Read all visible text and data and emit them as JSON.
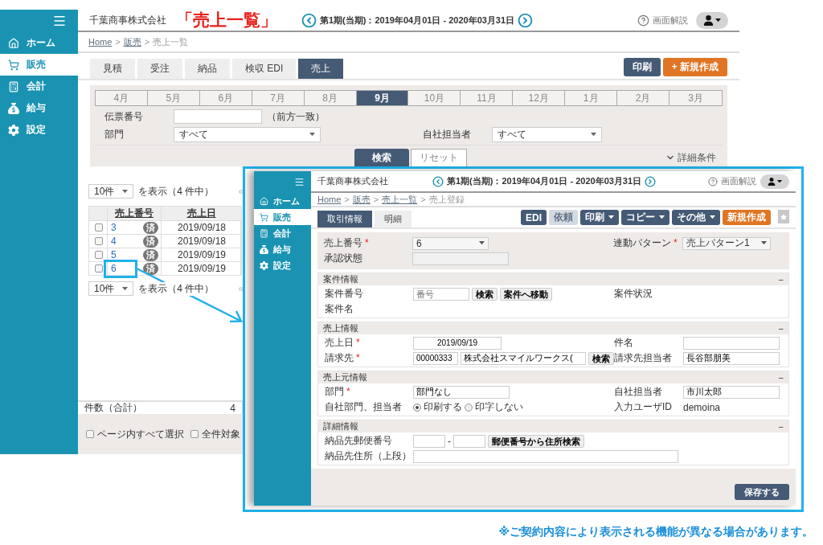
{
  "main": {
    "company": "千葉商事株式会社",
    "page_title": "「売上一覧」",
    "period": "第1期(当期)：2019年04月01日 - 2020年03月31日",
    "help": "画面解説"
  },
  "sidebar": {
    "items": [
      {
        "label": "ホーム",
        "selected": false
      },
      {
        "label": "販売",
        "selected": true
      },
      {
        "label": "会計",
        "selected": false
      },
      {
        "label": "給与",
        "selected": false
      },
      {
        "label": "設定",
        "selected": false
      }
    ]
  },
  "breadcrumb": {
    "separator": ">",
    "items": [
      {
        "label": "Home",
        "link": true
      },
      {
        "label": "販売",
        "link": true
      },
      {
        "label": "売上一覧",
        "link": false
      }
    ]
  },
  "tabs": [
    {
      "label": "見積",
      "selected": false
    },
    {
      "label": "受注",
      "selected": false
    },
    {
      "label": "納品",
      "selected": false
    },
    {
      "label": "検収 EDI",
      "selected": false
    },
    {
      "label": "売上",
      "selected": true
    }
  ],
  "actions": [
    {
      "label": "印刷",
      "kind": "dark"
    },
    {
      "label": "+ 新規作成",
      "kind": "primary"
    }
  ],
  "filter": {
    "months": [
      {
        "label": "4月",
        "selected": false
      },
      {
        "label": "5月",
        "selected": false
      },
      {
        "label": "6月",
        "selected": false
      },
      {
        "label": "7月",
        "selected": false
      },
      {
        "label": "8月",
        "selected": false
      },
      {
        "label": "9月",
        "selected": true
      },
      {
        "label": "10月",
        "selected": false
      },
      {
        "label": "11月",
        "selected": false
      },
      {
        "label": "12月",
        "selected": false
      },
      {
        "label": "1月",
        "selected": false
      },
      {
        "label": "2月",
        "selected": false
      },
      {
        "label": "3月",
        "selected": false
      }
    ],
    "slip": {
      "label": "伝票番号",
      "note": "（前方一致）"
    },
    "department": {
      "label": "部門",
      "value": "すべて"
    },
    "staff": {
      "label": "自社担当者",
      "value": "すべて"
    },
    "search": "検索",
    "reset": "リセット",
    "more": "詳細条件"
  },
  "pagers": [
    {
      "per_page": "10件",
      "summary": "を表示（4 件中）",
      "first": "«"
    },
    {
      "per_page": "10件",
      "summary": "を表示（4 件中）",
      "first": "«"
    }
  ],
  "table": {
    "columns": [
      "売上番号",
      "売上日"
    ],
    "rows": [
      {
        "checked": false,
        "number": "3",
        "badge": "済",
        "date": "2019/09/18",
        "highlighted": false
      },
      {
        "checked": false,
        "number": "4",
        "badge": "済",
        "date": "2019/09/18",
        "highlighted": false
      },
      {
        "checked": false,
        "number": "5",
        "badge": "済",
        "date": "2019/09/19",
        "highlighted": false
      },
      {
        "checked": false,
        "number": "6",
        "badge": "済",
        "date": "2019/09/19",
        "highlighted": true
      }
    ]
  },
  "totals": {
    "label": "件数（合計）",
    "value": "4"
  },
  "bulk": [
    {
      "label": "ページ内すべて選択",
      "checked": false
    },
    {
      "label": "全件対象",
      "checked": false
    }
  ],
  "detail": {
    "company": "千葉商事株式会社",
    "period": "第1期(当期)：2019年04月01日 - 2020年03月31日",
    "help": "画面解説",
    "sidebar": {
      "items": [
        {
          "label": "ホーム",
          "selected": false
        },
        {
          "label": "販売",
          "selected": true
        },
        {
          "label": "会計",
          "selected": false
        },
        {
          "label": "給与",
          "selected": false
        },
        {
          "label": "設定",
          "selected": false
        }
      ]
    },
    "breadcrumb": {
      "separator": ">",
      "items": [
        {
          "label": "Home",
          "link": true
        },
        {
          "label": "販売",
          "link": true
        },
        {
          "label": "売上一覧",
          "link": true
        },
        {
          "label": "売上登録",
          "link": false
        }
      ]
    },
    "tabs": [
      {
        "label": "取引情報",
        "selected": true
      },
      {
        "label": "明細",
        "selected": false
      }
    ],
    "actions": [
      {
        "label": "EDI",
        "kind": "dark",
        "dropdown": false,
        "disabled": false
      },
      {
        "label": "依頼",
        "kind": "dark",
        "dropdown": false,
        "disabled": true
      },
      {
        "label": "印刷",
        "kind": "dark",
        "dropdown": true,
        "disabled": false
      },
      {
        "label": "コピー",
        "kind": "dark",
        "dropdown": true,
        "disabled": false
      },
      {
        "label": "その他",
        "kind": "dark",
        "dropdown": true,
        "disabled": false
      },
      {
        "label": "新規作成",
        "kind": "primary",
        "dropdown": false,
        "disabled": false
      }
    ],
    "top": {
      "rows": [
        [
          {
            "label": "売上番号",
            "mark": "*",
            "kind": "select",
            "value": "6"
          },
          {
            "label": "連動パターン",
            "mark": "*",
            "kind": "select",
            "value": "売上パターン1"
          }
        ],
        [
          {
            "label": "承認状態",
            "kind": "input",
            "disabled": true
          }
        ]
      ]
    },
    "sections": [
      {
        "title": "案件情報",
        "toggle": "−",
        "rows": [
          [
            {
              "label": "案件番号",
              "kind": "lookup",
              "placeholder": "番号",
              "buttons": [
                "検索",
                "案件へ移動"
              ]
            },
            {
              "label": "案件状況",
              "kind": "none"
            }
          ],
          [
            {
              "label": "案件名",
              "kind": "none"
            }
          ]
        ]
      },
      {
        "title": "売上情報",
        "toggle": "−",
        "rows": [
          [
            {
              "label": "売上日",
              "mark": "*",
              "kind": "date",
              "value": "2019/09/19"
            },
            {
              "label": "件名",
              "kind": "input"
            }
          ],
          [
            {
              "label": "請求先",
              "mark": "*",
              "kind": "customer",
              "code": "00000333",
              "value": "株式会社スマイルワークス(",
              "buttons": [
                "検索"
              ]
            },
            {
              "label": "請求先担当者",
              "kind": "input",
              "value": "長谷部朋美"
            }
          ]
        ]
      },
      {
        "title": "売上元情報",
        "toggle": "−",
        "rows": [
          [
            {
              "label": "部門",
              "mark": "*",
              "kind": "input",
              "value": "部門なし"
            },
            {
              "label": "自社担当者",
              "kind": "input",
              "value": "市川太郎"
            }
          ],
          [
            {
              "label": "自社部門、担当者",
              "kind": "radio",
              "options": [
                {
                  "label": "印刷する",
                  "selected": true
                },
                {
                  "label": "印字しない",
                  "selected": false
                }
              ]
            },
            {
              "label": "入力ユーザID",
              "kind": "text",
              "value": "demoina"
            }
          ]
        ]
      },
      {
        "title": "詳細情報",
        "toggle": "−",
        "rows": [
          [
            {
              "label": "納品先郵便番号",
              "kind": "zip",
              "separator": "-",
              "buttons": [
                "郵便番号から住所検索"
              ]
            }
          ],
          [
            {
              "label": "納品先住所（上段）",
              "kind": "long"
            }
          ]
        ]
      }
    ],
    "save": "保存する"
  },
  "note": "※ご契約内容により表示される機能が異なる場合があります。"
}
